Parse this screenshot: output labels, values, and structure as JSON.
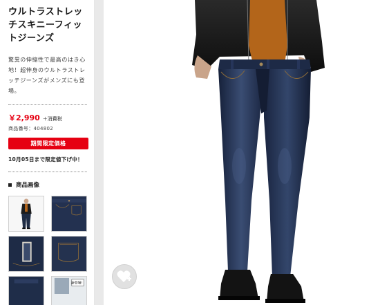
{
  "product": {
    "title": "ウルトラストレッチスキニーフィットジーンズ",
    "description": "驚異の伸縮性で最高のはき心地！超伸身のウルトラストレッチジーンズがメンズにも登場。",
    "price": "￥2,990",
    "tax_label": "＋消費税",
    "product_number_label": "商品番号：404802",
    "limited_price_label": "期間限定価格",
    "sale_note": "10月05日まで限定値下げ中！"
  },
  "gallery": {
    "heading": "商品画像",
    "thumb5_badge": "新登場！"
  },
  "icons": {
    "favorite": "heart-plus-icon"
  },
  "colors": {
    "accent_red": "#e60012",
    "denim": "#1f2c44"
  }
}
